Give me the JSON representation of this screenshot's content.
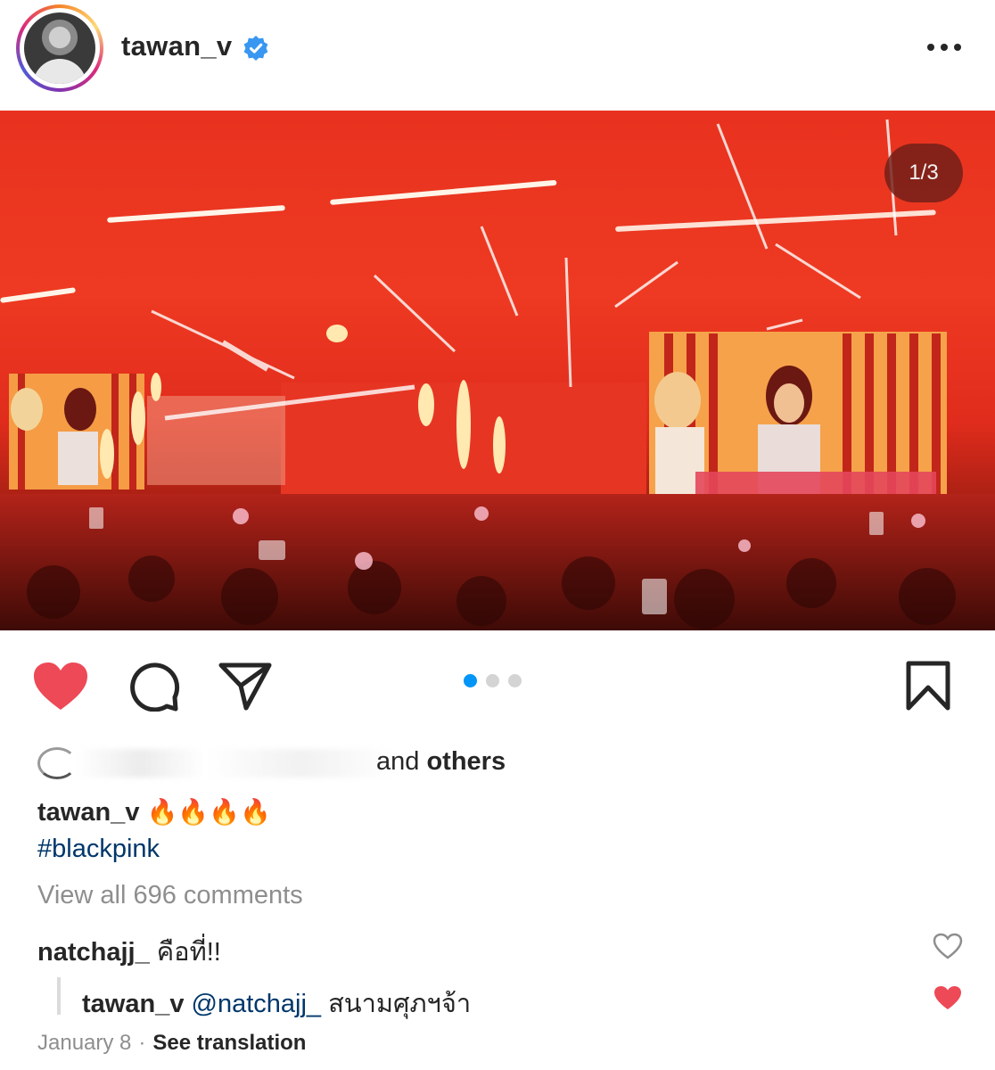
{
  "post": {
    "username": "tawan_v",
    "verified": true,
    "media_counter": "1/3",
    "carousel": {
      "total": 3,
      "active": 1
    },
    "liked": true
  },
  "likes": {
    "text_and": "and",
    "text_others": "others"
  },
  "caption": {
    "username": "tawan_v",
    "emojis": "🔥🔥🔥🔥",
    "hashtag": "#blackpink"
  },
  "comments_link": "View all 696 comments",
  "comments": [
    {
      "username": "natchajj_",
      "text": "คือที่!!",
      "liked": false
    }
  ],
  "reply": {
    "username": "tawan_v",
    "mention": "@natchajj_",
    "text": "สนามศุภฯจ้า",
    "liked": true
  },
  "meta": {
    "date": "January 8",
    "separator": "·",
    "see_translation": "See translation"
  },
  "colors": {
    "like_red": "#ed4956",
    "link_blue": "#00376b",
    "accent_blue": "#0095f6",
    "muted": "#8e8e8e"
  },
  "icons": [
    "more-icon",
    "verified-badge-icon",
    "heart-icon",
    "comment-icon",
    "share-icon",
    "bookmark-icon"
  ]
}
